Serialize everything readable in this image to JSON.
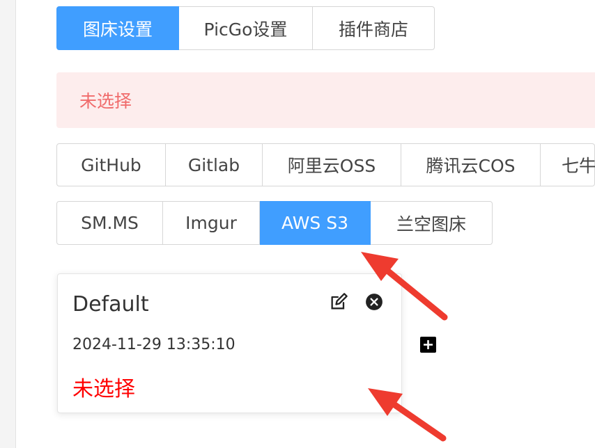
{
  "top_tabs": [
    {
      "label": "图床设置",
      "active": true
    },
    {
      "label": "PicGo设置",
      "active": false
    },
    {
      "label": "插件商店",
      "active": false
    }
  ],
  "alert": {
    "text": "未选择"
  },
  "uploaders_row1": [
    {
      "label": "GitHub"
    },
    {
      "label": "Gitlab"
    },
    {
      "label": "阿里云OSS"
    },
    {
      "label": "腾讯云COS"
    },
    {
      "label": "七牛"
    }
  ],
  "uploaders_row2": [
    {
      "label": "SM.MS",
      "active": false
    },
    {
      "label": "Imgur",
      "active": false
    },
    {
      "label": "AWS S3",
      "active": true
    },
    {
      "label": "兰空图床",
      "active": false
    }
  ],
  "config_card": {
    "title": "Default",
    "date": "2024-11-29 13:35:10",
    "status": "未选择"
  },
  "icons": {
    "edit": "edit-icon",
    "close": "close-circle-icon",
    "add": "add-square-icon",
    "annotation": "red-arrow"
  },
  "colors": {
    "primary": "#409eff",
    "alert_bg": "#fdeded",
    "alert_text": "#f06b6b",
    "status_red": "#ff0000",
    "arrow_red": "#ee3b2f"
  }
}
